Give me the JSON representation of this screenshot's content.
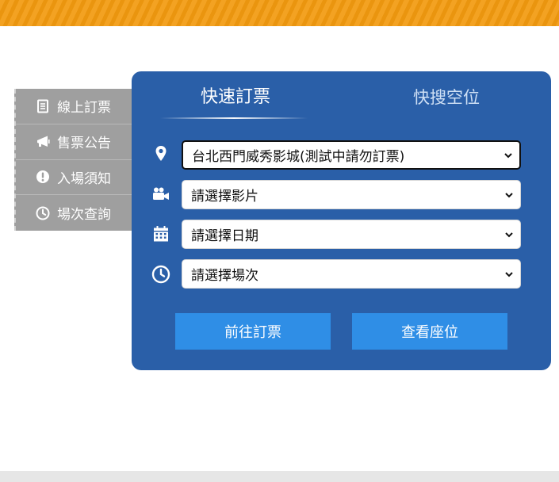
{
  "side_menu": {
    "items": [
      {
        "label": "線上訂票",
        "icon": "document-icon"
      },
      {
        "label": "售票公告",
        "icon": "megaphone-icon"
      },
      {
        "label": "入場須知",
        "icon": "exclamation-circle-icon"
      },
      {
        "label": "場次查詢",
        "icon": "clock-icon"
      }
    ]
  },
  "panel": {
    "tabs": [
      {
        "label": "快速訂票",
        "active": true
      },
      {
        "label": "快搜空位",
        "active": false
      }
    ],
    "selects": {
      "cinema": {
        "value": "台北西門威秀影城(測試中請勿訂票)",
        "icon": "location-pin-icon"
      },
      "movie": {
        "value": "請選擇影片",
        "icon": "video-camera-icon"
      },
      "date": {
        "value": "請選擇日期",
        "icon": "calendar-icon"
      },
      "showtime": {
        "value": "請選擇場次",
        "icon": "clock-icon"
      }
    },
    "buttons": {
      "book": "前往訂票",
      "seats": "查看座位"
    }
  },
  "colors": {
    "banner": "#f29a0f",
    "panel": "#2a5fa8",
    "button": "#2f8ee6",
    "side_menu": "#9f9f9f"
  }
}
